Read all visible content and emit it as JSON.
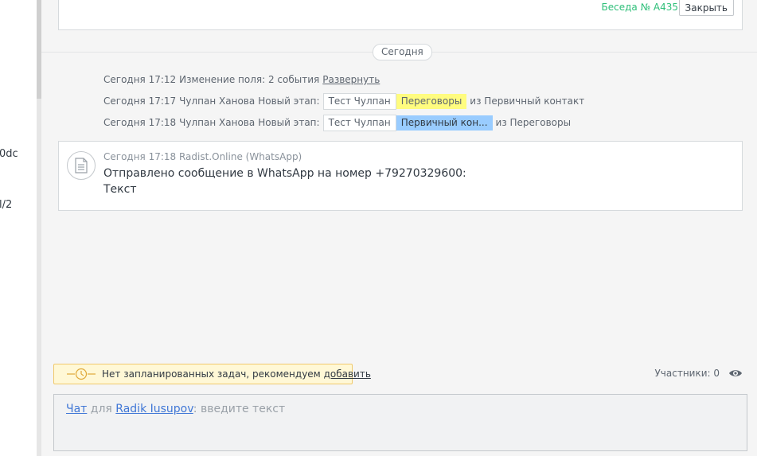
{
  "left_panel": {
    "fragment_1": "0dc",
    "fragment_2": "l/2"
  },
  "top_card": {
    "conversation_link": "Беседа № A435",
    "close_label": "Закрыть"
  },
  "day_separator": {
    "label": "Сегодня"
  },
  "events": [
    {
      "time": "Сегодня 17:12",
      "text": "Изменение поля: 2 события",
      "link": "Развернуть"
    },
    {
      "time": "Сегодня 17:17",
      "author": "Чулпан Ханова",
      "action": "Новый этап:",
      "deal": "Тест Чулпан",
      "stage": "Переговоры",
      "stage_color": "#fffc7f",
      "from_text": "из Первичный контакт"
    },
    {
      "time": "Сегодня 17:18",
      "author": "Чулпан Ханова",
      "action": "Новый этап:",
      "deal": "Тест Чулпан",
      "stage": "Первичный кон...",
      "stage_color": "#99ccff",
      "from_text": "из Переговоры"
    }
  ],
  "message": {
    "meta": "Сегодня 17:18 Radist.Online (WhatsApp)",
    "line1": "Отправлено сообщение в WhatsApp на номер +79270329600:",
    "line2": "Текст",
    "icon": "document-icon"
  },
  "tasks_bar": {
    "text": "Нет запланированных задач, рекомендуем ",
    "link": "добавить",
    "icon": "clock-icon"
  },
  "participants": {
    "label": "Участники: 0",
    "icon": "eye-icon"
  },
  "composer": {
    "mode_link": "Чат",
    "for_text": " для ",
    "recipient_link": "Radik Iusupov",
    "placeholder": ": введите текст"
  },
  "colors": {
    "accent_green": "#2ebf79",
    "link_blue": "#4077d6",
    "task_bg": "#fff8d6"
  }
}
